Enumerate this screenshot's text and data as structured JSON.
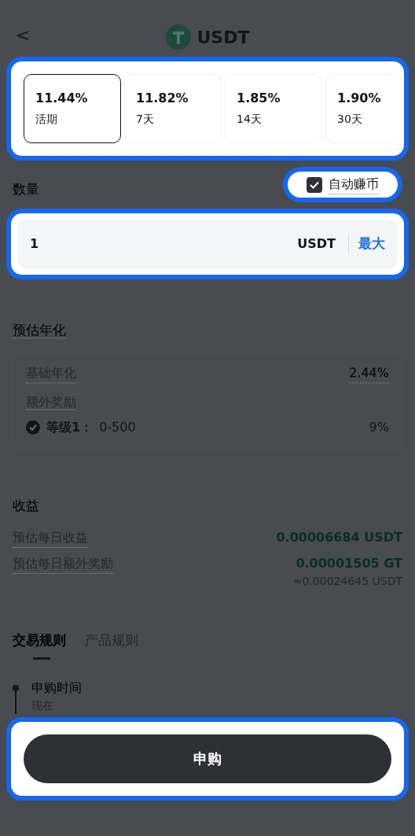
{
  "header": {
    "back": "<",
    "title": "USDT"
  },
  "terms": [
    {
      "rate": "11.44%",
      "label": "活期",
      "selected": true
    },
    {
      "rate": "11.82%",
      "label": "7天",
      "selected": false
    },
    {
      "rate": "1.85%",
      "label": "14天",
      "selected": false
    },
    {
      "rate": "1.90%",
      "label": "30天",
      "selected": false
    }
  ],
  "auto_earn": {
    "label": "自动赚币",
    "checked": true
  },
  "quantity": {
    "label": "数量",
    "value": "1",
    "unit": "USDT",
    "max_label": "最大"
  },
  "estimated_apr": {
    "title": "预估年化",
    "base_label": "基础年化",
    "base_value": "2.44%",
    "bonus_label": "额外奖励",
    "tiers": [
      {
        "label": "等级1：",
        "range": "0-500",
        "value": "9%",
        "checked": true
      }
    ]
  },
  "earnings": {
    "title": "收益",
    "rows": [
      {
        "label": "预估每日收益",
        "value": "0.00006684 USDT"
      },
      {
        "label": "预估每日额外奖励",
        "value": "0.00001505 GT",
        "note": "≈0.00024645 USDT"
      }
    ]
  },
  "rule_tabs": [
    {
      "label": "交易规则",
      "selected": true
    },
    {
      "label": "产品规则",
      "selected": false
    }
  ],
  "timeline": [
    {
      "title": "申购时间",
      "subtitle": "现在"
    }
  ],
  "submit": "申购"
}
